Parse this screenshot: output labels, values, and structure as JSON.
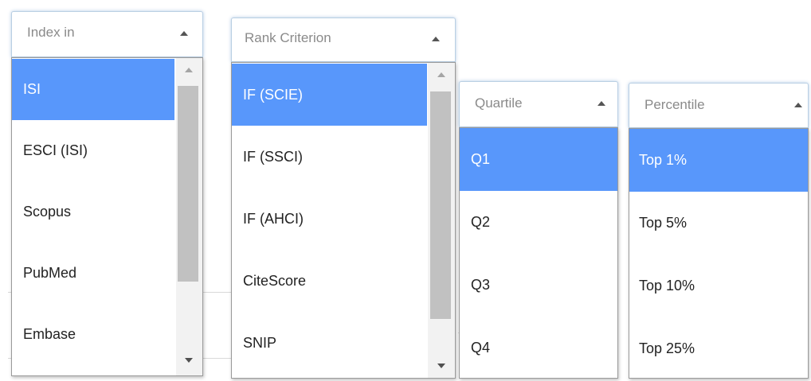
{
  "colors": {
    "selected_bg": "#5897fb",
    "selected_text": "#ffffff",
    "header_border": "#b9cfe3"
  },
  "index_in": {
    "placeholder": "Index in",
    "options": [
      "ISI",
      "ESCI (ISI)",
      "Scopus",
      "PubMed",
      "Embase"
    ],
    "selected": "ISI"
  },
  "rank_criterion": {
    "placeholder": "Rank Criterion",
    "options": [
      "IF (SCIE)",
      "IF (SSCI)",
      "IF (AHCI)",
      "CiteScore",
      "SNIP"
    ],
    "selected": "IF (SCIE)"
  },
  "quartile": {
    "placeholder": "Quartile",
    "options": [
      "Q1",
      "Q2",
      "Q3",
      "Q4"
    ],
    "selected": "Q1"
  },
  "percentile": {
    "placeholder": "Percentile",
    "options": [
      "Top 1%",
      "Top 5%",
      "Top 10%",
      "Top 25%"
    ],
    "selected": "Top 1%"
  }
}
